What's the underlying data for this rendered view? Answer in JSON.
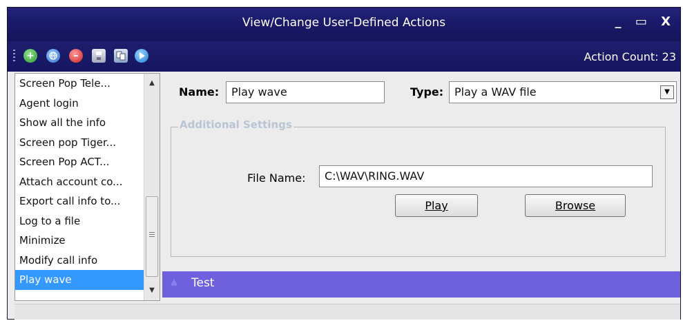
{
  "window": {
    "title": "View/Change User-Defined Actions",
    "controls": {
      "minimize": "_",
      "maximize": "▭",
      "close": "X"
    }
  },
  "toolbar": {
    "action_count": "Action Count: 23",
    "icons": [
      "add-icon",
      "globe-icon",
      "delete-icon",
      "save-icon",
      "copy-icon",
      "play-icon"
    ],
    "icon_colors": {
      "add": "#3aa83a",
      "globe": "#2f77d0",
      "delete": "#d83030",
      "save": "#c8c8d8",
      "copy": "#8fa8c8",
      "play": "#2c8fe0"
    }
  },
  "action_list": {
    "items": [
      "Screen Pop Tele...",
      "Agent login",
      "Show all the info",
      "Screen pop Tiger...",
      "Screen Pop ACT...",
      "Attach account co...",
      "Export call info to...",
      "Log to a file",
      "Minimize",
      "Modify call info",
      "Play wave"
    ],
    "selected": "Play wave"
  },
  "editor": {
    "name_label": "Name:",
    "name_value": "Play wave",
    "type_label": "Type:",
    "type_value": "Play a WAV file",
    "group_title": "Additional Settings",
    "file_name_label": "File Name:",
    "file_name_value": "C:\\WAV\\RING.WAV",
    "play_label": "Play",
    "browse_label": "Browse"
  },
  "test_section": {
    "label": "Test"
  },
  "colors": {
    "title_bar": "#1a1a6a",
    "selection": "#3399ff",
    "test_bar": "#6f60dd"
  }
}
